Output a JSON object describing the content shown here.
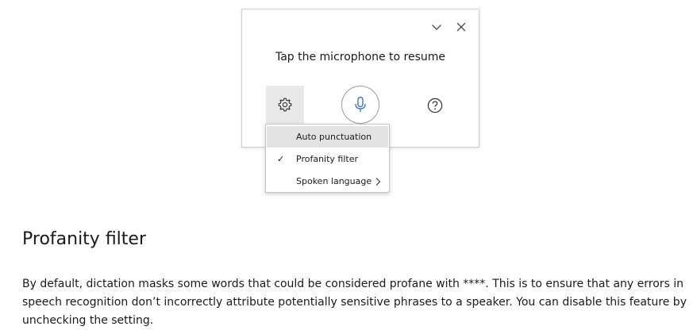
{
  "dictation_panel": {
    "title": "Tap the microphone to resume",
    "collapse_icon": "chevron-down-icon",
    "close_icon": "close-icon",
    "settings_icon": "gear-icon",
    "mic_icon": "microphone-icon",
    "help_icon": "help-circle-icon",
    "mic_color": "#2f6fb3"
  },
  "settings_menu": {
    "items": [
      {
        "label": "Auto punctuation",
        "checked": false,
        "highlighted": true
      },
      {
        "label": "Profanity filter",
        "checked": true,
        "highlighted": false
      },
      {
        "label": "Spoken language",
        "checked": false,
        "has_submenu": true
      }
    ],
    "check_glyph": "✓"
  },
  "article": {
    "heading": "Profanity filter",
    "paragraph": "By default, dictation masks some words that could be considered profane with ****. This is to ensure that any errors in speech recognition don’t incorrectly attribute potentially sensitive phrases to a speaker. You can disable this feature by unchecking the setting."
  }
}
